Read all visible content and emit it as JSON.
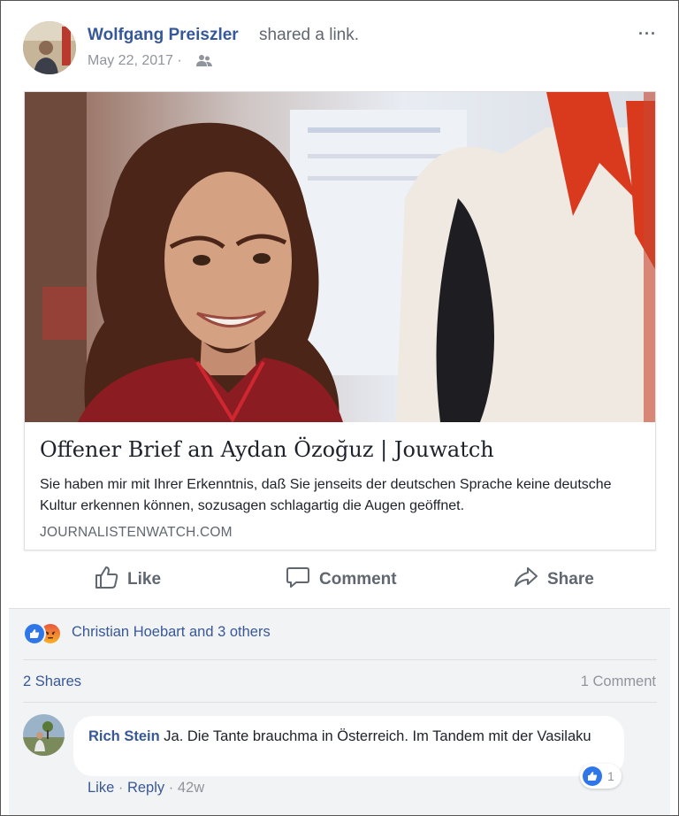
{
  "post": {
    "author": "Wolfgang Preiszler",
    "action": "shared a link.",
    "date": "May 22, 2017 ·",
    "audience_icon": "friends-icon",
    "more_label": "···"
  },
  "link": {
    "title": "Offener Brief an Aydan Özoğuz | Jouwatch",
    "description": "Sie haben mir mit Ihrer Erkenntnis, daß Sie jenseits der deutschen Sprache keine deutsche Kultur erkennen können, sozusagen schlagartig die Augen geöffnet.",
    "domain": "JOURNALISTENWATCH.COM"
  },
  "actions": {
    "like": "Like",
    "comment": "Comment",
    "share": "Share"
  },
  "reactions": {
    "types": [
      "like",
      "angry"
    ],
    "summary": "Christian Hoebart and 3 others"
  },
  "stats": {
    "shares": "2 Shares",
    "comments": "1 Comment"
  },
  "comment": {
    "author": "Rich Stein",
    "text": "Ja. Die Tante brauchma in Österreich. Im Tandem mit der Vasilaku",
    "like": "Like",
    "sep": "·",
    "reply": "Reply",
    "time": "42w",
    "reaction_count": "1"
  },
  "colors": {
    "link": "#365899",
    "secondary_text": "#616770",
    "like_blue": "#2f77e8",
    "comment_bg": "#f2f3f5"
  }
}
